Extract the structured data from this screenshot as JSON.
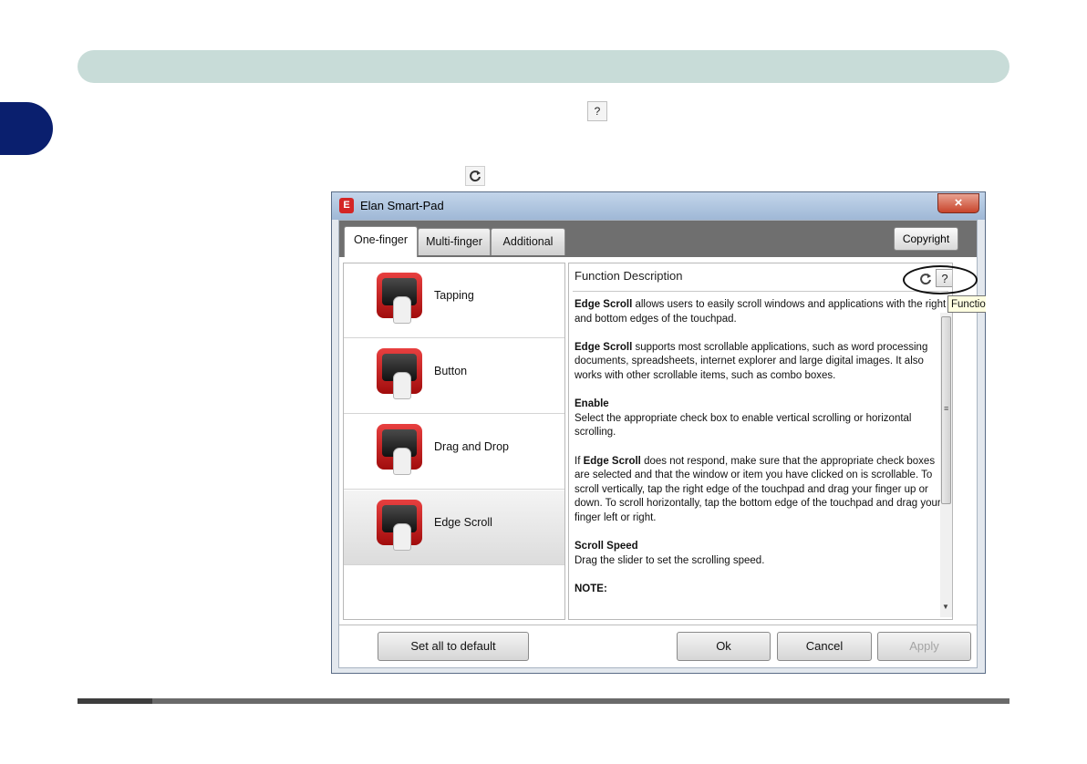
{
  "document": {
    "inline_help_icon": "?",
    "inline_refresh_icon": "refresh-icon"
  },
  "window": {
    "title": "Elan Smart-Pad",
    "close_label": "×",
    "tabs": [
      {
        "label": "One-finger",
        "active": true
      },
      {
        "label": "Multi-finger",
        "active": false
      },
      {
        "label": "Additional",
        "active": false
      }
    ],
    "copyright_label": "Copyright",
    "function_items": [
      {
        "label": "Tapping",
        "icon": "tapping-icon"
      },
      {
        "label": "Button",
        "icon": "button-icon"
      },
      {
        "label": "Drag and Drop",
        "icon": "drag-and-drop-icon"
      },
      {
        "label": "Edge Scroll",
        "icon": "edge-scroll-icon",
        "selected": true
      }
    ],
    "description": {
      "header": "Function Description",
      "help_label": "?",
      "p1_bold": "Edge Scroll",
      "p1_text": " allows users to easily scroll windows and applications with the right and bottom edges of the touchpad.",
      "p2_bold": "Edge Scroll",
      "p2_text": " supports most scrollable applications, such as word processing documents, spreadsheets, internet explorer and large digital images. It also works with other scrollable items, such as combo boxes.",
      "p3_heading": "Enable",
      "p3_text": "Select the appropriate check box to enable vertical scrolling or horizontal scrolling.",
      "p4_prefix": "If ",
      "p4_bold": "Edge Scroll",
      "p4_text": " does not respond, make sure that the appropriate check boxes are selected and that the window or item you have clicked on is scrollable. To scroll vertically, tap the right edge of the touchpad and drag your finger up or down. To scroll horizontally, tap the bottom edge of the touchpad and drag your finger left or right.",
      "p5_heading": "Scroll Speed",
      "p5_text": "Drag the slider to set the scrolling speed.",
      "p6_heading": "NOTE:"
    },
    "tooltip": "Function",
    "buttons": {
      "set_default": "Set all to default",
      "ok": "Ok",
      "cancel": "Cancel",
      "apply": "Apply"
    }
  },
  "colors": {
    "header_bar": "#c8dcd8",
    "chapter_tab": "#0a1f6e",
    "icon_red": "#d42525"
  }
}
